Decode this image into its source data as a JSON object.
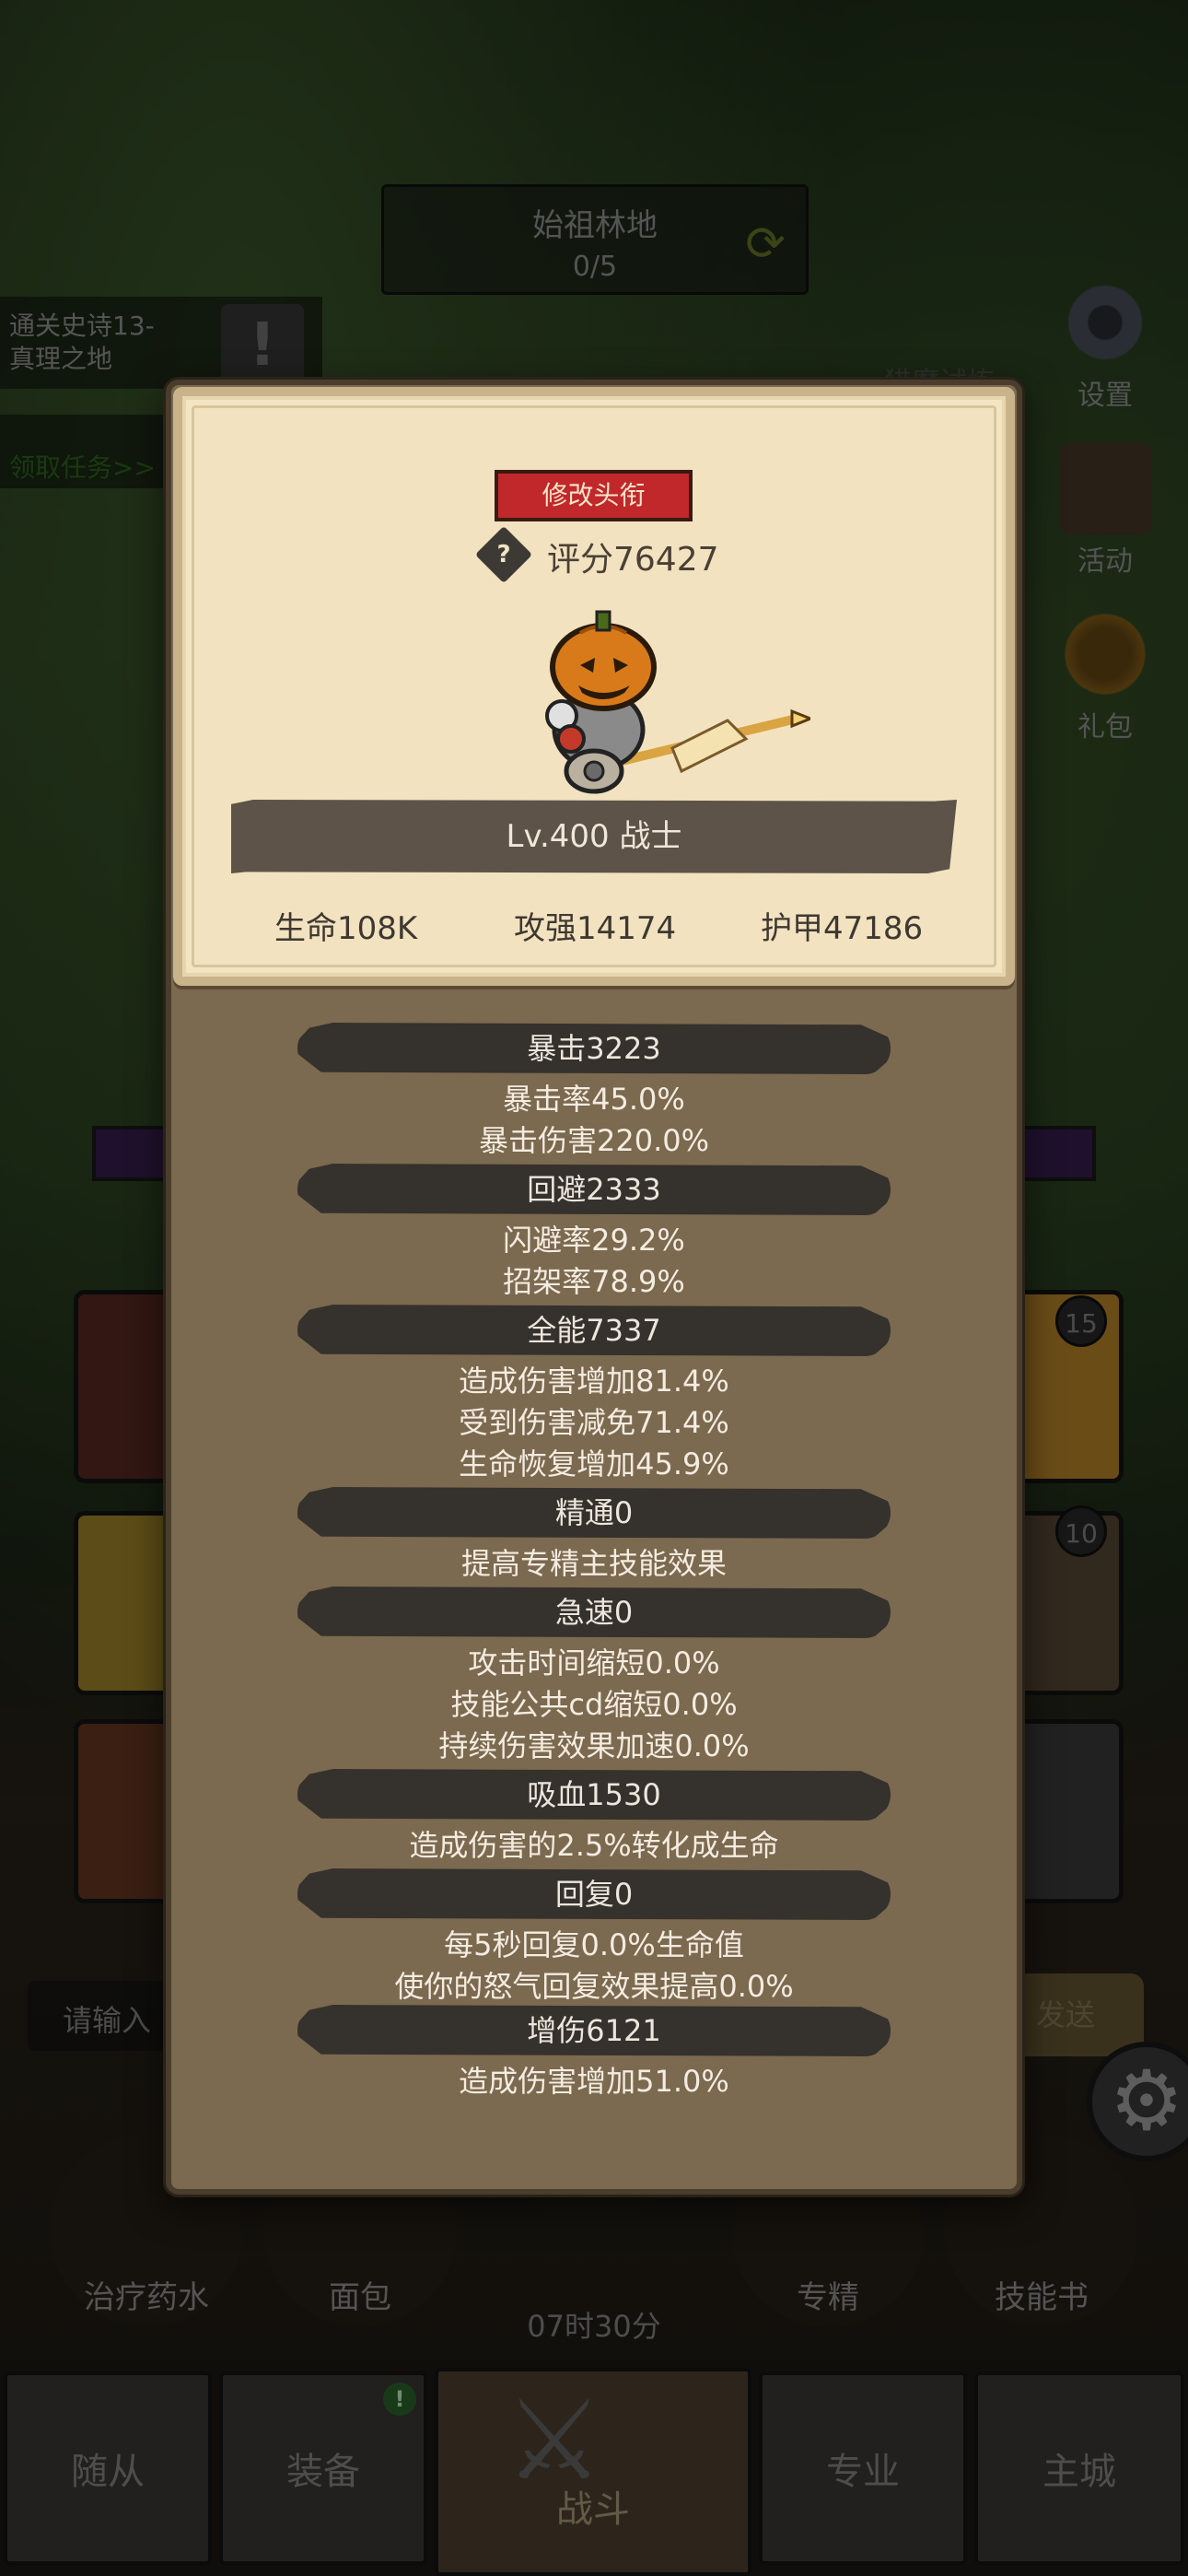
{
  "zone": {
    "title": "始祖林地",
    "progress": "0/5"
  },
  "quest": {
    "line1": "通关史诗13-",
    "line2": "真理之地",
    "claim": "领取任务>>"
  },
  "side_menu": {
    "hunt": "猎魔试炼",
    "settings": "设置",
    "events": "活动",
    "gift": "礼包"
  },
  "card_badges": {
    "badge1": "15",
    "badge2": "10"
  },
  "chat": {
    "input_placeholder": "请输入",
    "send": "发送"
  },
  "consumables": {
    "potion": "治疗药水",
    "bread": "面包",
    "spec": "专精",
    "skillbook": "技能书"
  },
  "timer": "07时30分",
  "nav": {
    "followers": "随从",
    "equipment": "装备",
    "battle": "战斗",
    "profession": "专业",
    "city": "主城",
    "equipment_badge": "!"
  },
  "profile": {
    "change_title": "修改头衔",
    "help": "?",
    "score": "评分76427",
    "level_class": "Lv.400 战士",
    "hp": "生命108K",
    "attack": "攻强14174",
    "armor": "护甲47186"
  },
  "stats": {
    "crit": {
      "header": "暴击3223",
      "lines": [
        "暴击率45.0%",
        "暴击伤害220.0%"
      ]
    },
    "dodge": {
      "header": "回避2333",
      "lines": [
        "闪避率29.2%",
        "招架率78.9%"
      ]
    },
    "versatility": {
      "header": "全能7337",
      "lines": [
        "造成伤害增加81.4%",
        "受到伤害减免71.4%",
        "生命恢复增加45.9%"
      ]
    },
    "mastery": {
      "header": "精通0",
      "lines": [
        "提高专精主技能效果"
      ]
    },
    "haste": {
      "header": "急速0",
      "lines": [
        "攻击时间缩短0.0%",
        "技能公共cd缩短0.0%",
        "持续伤害效果加速0.0%"
      ]
    },
    "lifesteal": {
      "header": "吸血1530",
      "lines": [
        "造成伤害的2.5%转化成生命"
      ]
    },
    "regen": {
      "header": "回复0",
      "lines": [
        "每5秒回复0.0%生命值",
        "使你的怒气回复效果提高0.0%"
      ]
    },
    "damage_boost": {
      "header": "增伤6121",
      "lines": [
        "造成伤害增加51.0%"
      ]
    }
  },
  "colors": {
    "title_button": "#c0282b",
    "panel": "#7b6950",
    "card_bg": "#f3e4c2",
    "stat_header": "#35312c"
  }
}
